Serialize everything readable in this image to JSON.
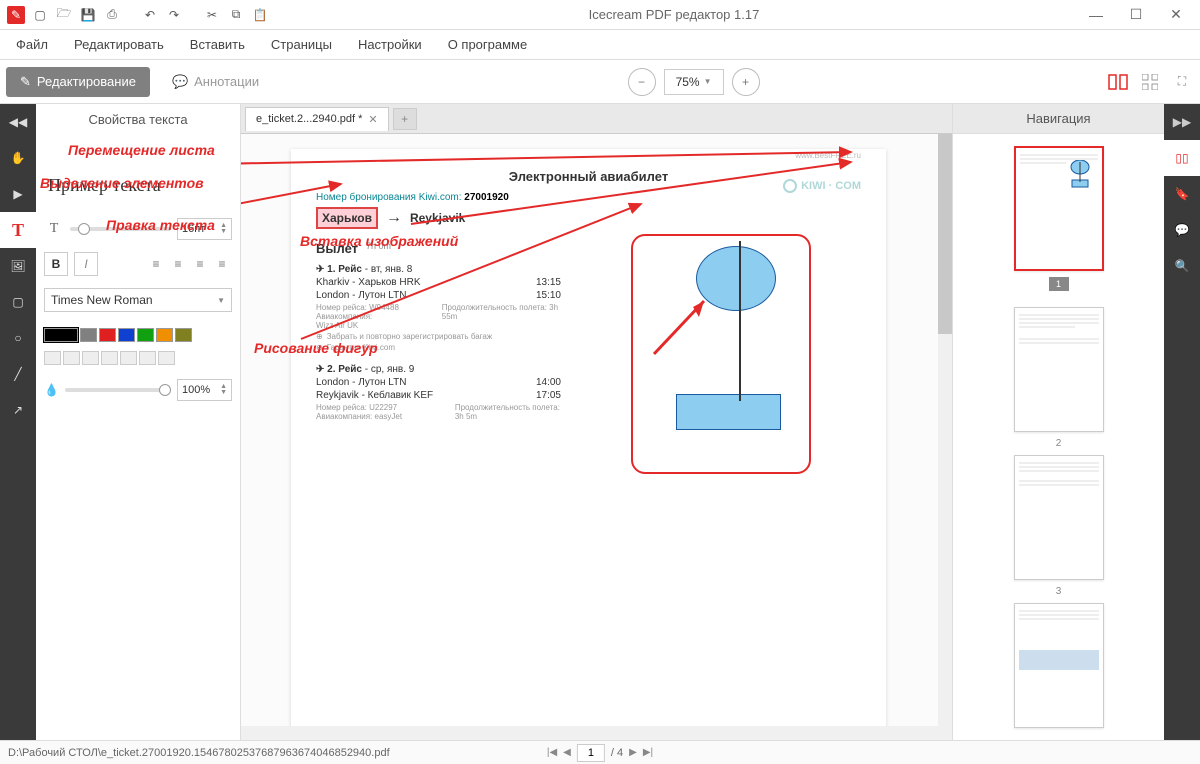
{
  "window": {
    "title": "Icecream PDF редактор 1.17"
  },
  "menu": {
    "file": "Файл",
    "edit": "Редактировать",
    "insert": "Вставить",
    "pages": "Страницы",
    "settings": "Настройки",
    "about": "О программе"
  },
  "modes": {
    "edit": "Редактирование",
    "annotate": "Аннотации",
    "zoom": "75%"
  },
  "text_props": {
    "title": "Свойства текста",
    "sample": "Пример текста",
    "font_size": "16пт",
    "font_family": "Times New Roman",
    "opacity": "100%"
  },
  "document": {
    "tab_name": "e_ticket.2...2940.pdf *",
    "page_title": "Электронный авиабилет",
    "booking_label": "Номер бронирования Kiwi.com:",
    "booking_code": "27001920",
    "from": "Харьков",
    "to": "Reykjavik",
    "depart_label": "Вылет",
    "duration": "7h 0m",
    "flight1_header": "1. Рейс",
    "flight1_date": "- вт, янв. 8",
    "flight1_from": "Kharkiv - Харьков HRK",
    "flight1_time1": "13:15",
    "flight1_to": "London - Лутон LTN",
    "flight1_time2": "15:10",
    "flight1_num": "Номер рейса: W94488",
    "flight1_airline": "Авиакомпания:",
    "flight1_airlinename": "Wizz Air UK",
    "flight1_dur": "Продолжительность полета: 3h 55m",
    "bullet1": "Забрать и повторно зарегистрировать багаж",
    "bullet2": "Гарантия Kiwi.com",
    "flight2_header": "2. Рейс",
    "flight2_date": "- ср, янв. 9",
    "flight2_from": "London - Лутон LTN",
    "flight2_time1": "14:00",
    "flight2_to": "Reykjavik - Кеблавик KEF",
    "flight2_time2": "17:05",
    "flight2_num": "Номер рейса: U22297",
    "flight2_airline": "Авиакомпания: easyJet",
    "flight2_dur": "Продолжительность полета: 3h 5m",
    "kiwi": "KIWI · COM",
    "watermark": "www.BestFREE.ru"
  },
  "annotations": {
    "move": "Перемещение листа",
    "select": "Выделение элементов",
    "edit_text": "Правка текста",
    "insert_image": "Вставка изображений",
    "draw_shapes": "Рисование фигур"
  },
  "navigation": {
    "title": "Навигация",
    "page1": "1",
    "page2": "2",
    "page3": "3"
  },
  "status": {
    "path": "D:\\Рабочий СТОЛ\\e_ticket.27001920.15467802537687963674046852940.pdf",
    "page_current": "1",
    "page_sep": "/ 4"
  },
  "colors": [
    "#000000",
    "#808080",
    "#e02020",
    "#1040d0",
    "#10a010",
    "#f09000",
    "#808020"
  ]
}
